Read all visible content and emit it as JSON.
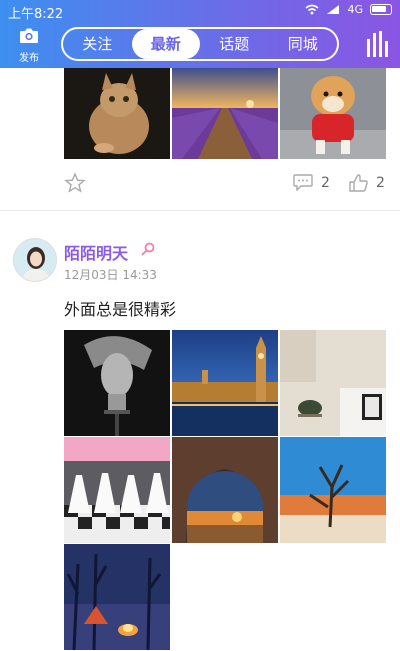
{
  "status_bar": {
    "time": "上午8:22",
    "signal": "4G",
    "battery": "battery"
  },
  "header": {
    "post_button_label": "发布",
    "post_icon": "camera-icon",
    "menu_icon": "equalizer-icon",
    "tabs": [
      {
        "label": "关注",
        "active": false
      },
      {
        "label": "最新",
        "active": true
      },
      {
        "label": "话题",
        "active": false
      },
      {
        "label": "同城",
        "active": false
      }
    ],
    "gradient_colors": [
      "#3d8ff0",
      "#8b55e3"
    ]
  },
  "previous_post": {
    "images": [
      "cat",
      "lavender-field",
      "pomeranian-dog"
    ],
    "favorite_icon": "star-icon",
    "comment_count": "2",
    "like_count": "2"
  },
  "post": {
    "username": "陌陌明天",
    "gender_icon": "female-icon",
    "timestamp": "12月03日 14:33",
    "text": "外面总是很精彩",
    "images": [
      "sculpture-head",
      "big-ben-night",
      "room-interior",
      "wedding-dresses",
      "canyon-sunset",
      "dead-tree-desert",
      "camp-fire-forest"
    ]
  },
  "colors": {
    "accent": "#8a5ce6",
    "tab_active_text": "#6a64e8"
  }
}
